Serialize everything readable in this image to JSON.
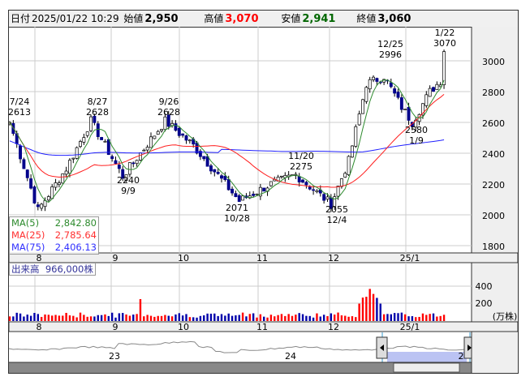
{
  "header": {
    "date_label": "日付",
    "date": "2025/01/22 10:29",
    "open_label": "始値",
    "open": "2,950",
    "high_label": "高値",
    "high": "3,070",
    "low_label": "安値",
    "low": "2,941",
    "close_label": "終値",
    "close": "3,060"
  },
  "colors": {
    "up_candle": "#ffffff",
    "down_candle": "#00008b",
    "ma5": "#2e8b2e",
    "ma25": "#ff2020",
    "ma75": "#2020ff",
    "vol_up": "#ff0000",
    "vol_down": "#0000aa"
  },
  "legend": [
    {
      "label": "MA(5)",
      "value": "2,842.80"
    },
    {
      "label": "MA(25)",
      "value": "2,785.64"
    },
    {
      "label": "MA(75)",
      "value": "2,406.13"
    }
  ],
  "volume": {
    "label": "出来高",
    "value": "966,000株",
    "ticks": [
      "400",
      "200"
    ],
    "unit": "(万株)"
  },
  "price_axis": [
    "3000",
    "2800",
    "2600",
    "2400",
    "2200",
    "2000",
    "1800"
  ],
  "month_labels": [
    "8",
    "9",
    "10",
    "11",
    "12",
    "25/1"
  ],
  "navigator": {
    "year_labels": [
      "23",
      "24",
      "2"
    ]
  },
  "chart_data": {
    "type": "candlestick",
    "ylim": [
      1800,
      3050
    ],
    "keypoints": [
      {
        "day": 0,
        "close": 2600
      },
      {
        "day": 8,
        "close": 2030
      },
      {
        "day": 16,
        "close": 2300
      },
      {
        "day": 23,
        "close": 2610
      },
      {
        "day": 32,
        "close": 2250
      },
      {
        "day": 44,
        "close": 2610
      },
      {
        "day": 52,
        "close": 2450
      },
      {
        "day": 65,
        "close": 2090
      },
      {
        "day": 74,
        "close": 2200
      },
      {
        "day": 81,
        "close": 2260
      },
      {
        "day": 91,
        "close": 2070
      },
      {
        "day": 96,
        "close": 2350
      },
      {
        "day": 101,
        "close": 2850
      },
      {
        "day": 106,
        "close": 2900
      },
      {
        "day": 111,
        "close": 2700
      },
      {
        "day": 114,
        "close": 2600
      },
      {
        "day": 119,
        "close": 2800
      },
      {
        "day": 122,
        "close": 2870
      },
      {
        "day": 123,
        "close": 3060
      }
    ],
    "annotations": [
      {
        "date": "7/24",
        "value": "2613"
      },
      {
        "date": "8/27",
        "value": "2628"
      },
      {
        "date": "9/26",
        "value": "2628"
      },
      {
        "date": "9/9",
        "value": "2240"
      },
      {
        "date": "10/28",
        "value": "2071"
      },
      {
        "date": "11/20",
        "value": "2275"
      },
      {
        "date": "12/4",
        "value": "2055"
      },
      {
        "date": "12/25",
        "value": "2996"
      },
      {
        "date": "1/9",
        "value": "2580"
      },
      {
        "date": "1/22",
        "value": "3070"
      }
    ]
  }
}
